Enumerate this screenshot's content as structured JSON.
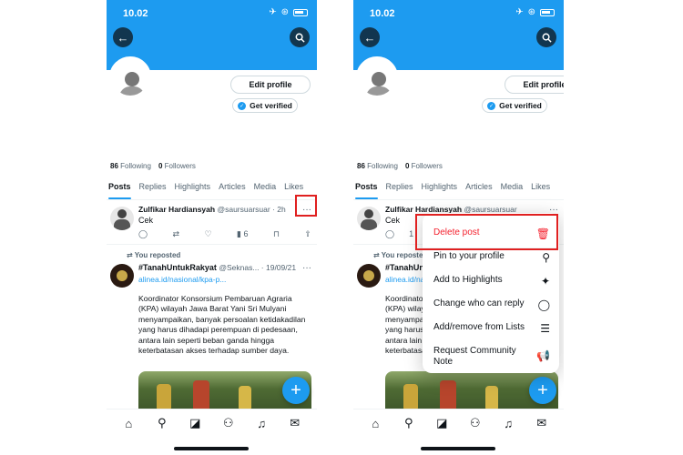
{
  "status": {
    "time": "10.02"
  },
  "profile": {
    "edit_profile": "Edit profile",
    "get_verified": "Get verified",
    "following_count": "86",
    "following_label": "Following",
    "followers_count": "0",
    "followers_label": "Followers"
  },
  "tabs": [
    "Posts",
    "Replies",
    "Highlights",
    "Articles",
    "Media",
    "Likes"
  ],
  "post1": {
    "name": "Zulfikar Hardiansyah",
    "handle": "@saursuarsuar",
    "time": "· 2h",
    "text": "Cek",
    "views": "6",
    "short_prefix": "1"
  },
  "post2": {
    "reposted_label": "You reposted",
    "name": "#TanahUntukRakyat",
    "meta": "@Seknas... · 19/09/21",
    "link": "alinea.id/nasional/kpa-p...",
    "body": "Koordinator Konsorsium Pembaruan Agraria (KPA) wilayah Jawa Barat Yani Sri Mulyani menyampaikan, banyak persoalan ketidakadilan yang harus  dihadapi perempuan di pedesaan, antara lain seperti beban ganda hingga keterbatasan akses terhadap sumber daya."
  },
  "menu": {
    "items": [
      {
        "label": "Delete post",
        "icon": "trash-icon"
      },
      {
        "label": "Pin to your profile",
        "icon": "pin-icon"
      },
      {
        "label": "Add to Highlights",
        "icon": "sparkle-icon"
      },
      {
        "label": "Change who can reply",
        "icon": "reply-bubble-icon"
      },
      {
        "label": "Add/remove from Lists",
        "icon": "list-icon"
      },
      {
        "label": "Request Community Note",
        "icon": "megaphone-icon"
      }
    ]
  },
  "colors": {
    "accent": "#1d9bf0",
    "delete": "#f4212e",
    "highlight": "#e02020"
  }
}
